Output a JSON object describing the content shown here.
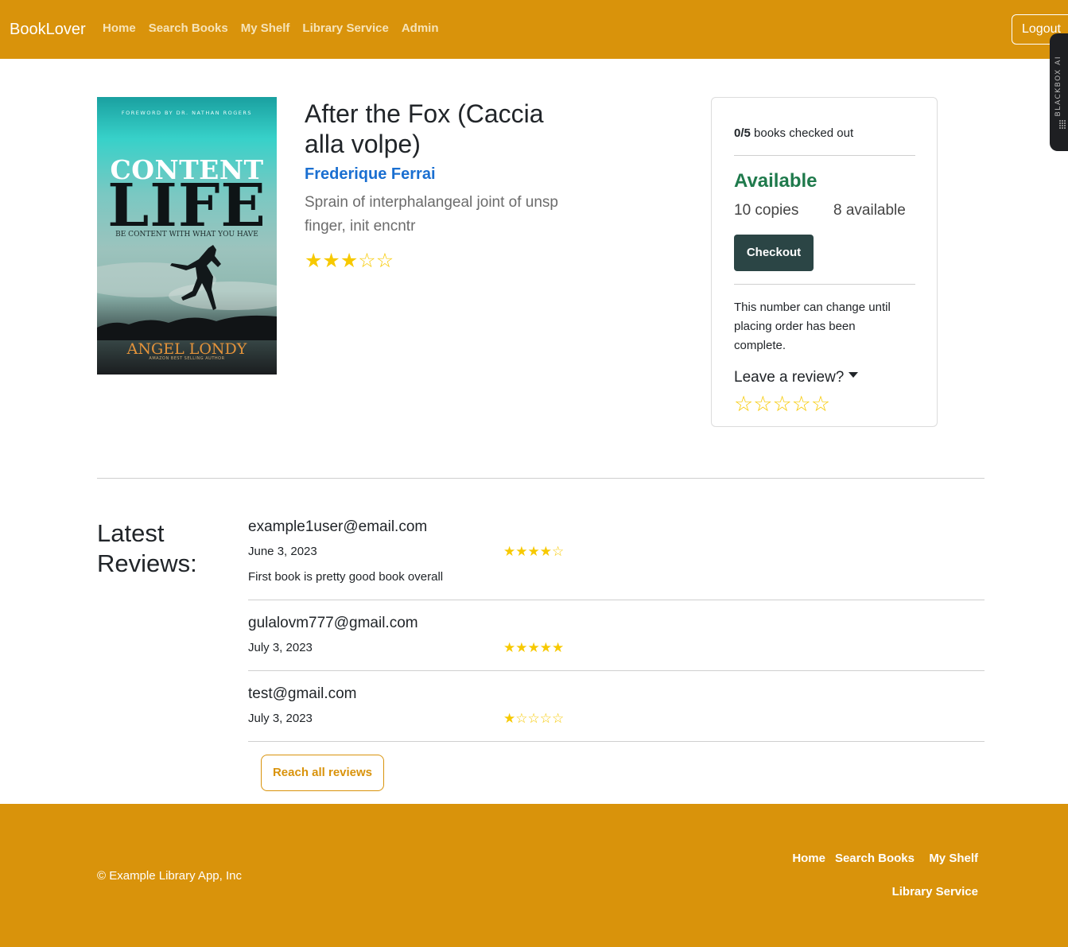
{
  "navbar": {
    "brand": "BookLover",
    "links": [
      "Home",
      "Search Books",
      "My Shelf",
      "Library Service",
      "Admin"
    ],
    "logout": "Logout",
    "side_widget": "BLACKBOX AI"
  },
  "cover": {
    "foreword": "FOREWORD BY DR. NATHAN ROGERS",
    "title_line1": "CONTENT",
    "title_line2": "LIFE",
    "subtitle": "BE CONTENT WITH WHAT YOU HAVE",
    "author": "ANGEL LONDY",
    "tagline": "AMAZON BEST SELLING AUTHOR"
  },
  "book": {
    "title": "After the Fox (Caccia alla volpe)",
    "author": "Frederique Ferrai",
    "description": "Sprain of interphalangeal joint of unsp finger, init encntr",
    "rating": 3,
    "rating_max": 5
  },
  "checkout": {
    "count_bold": "0/5",
    "count_text": " books checked out",
    "status": "Available",
    "copies": "10 copies",
    "available": "8 available",
    "button": "Checkout",
    "note": "This number can change until placing order has been complete.",
    "leave_review": "Leave a review?",
    "review_input_rating": 0
  },
  "reviews": {
    "heading": "Latest Reviews:",
    "items": [
      {
        "email": "example1user@email.com",
        "date": "June 3, 2023",
        "rating": 4,
        "text": "First book is pretty good book overall"
      },
      {
        "email": "gulalovm777@gmail.com",
        "date": "July 3, 2023",
        "rating": 5,
        "text": ""
      },
      {
        "email": "test@gmail.com",
        "date": "July 3, 2023",
        "rating": 1,
        "text": ""
      }
    ],
    "reach_all": "Reach all reviews"
  },
  "footer": {
    "copyright": "© Example Library App, Inc",
    "links": [
      "Home",
      "Search Books",
      "My Shelf",
      "Library Service"
    ]
  },
  "colors": {
    "brand": "#d9930b",
    "star": "#f7c900",
    "available": "#1f7a4c",
    "author_link": "#1a6fd1",
    "checkout_button": "#2b4545"
  }
}
